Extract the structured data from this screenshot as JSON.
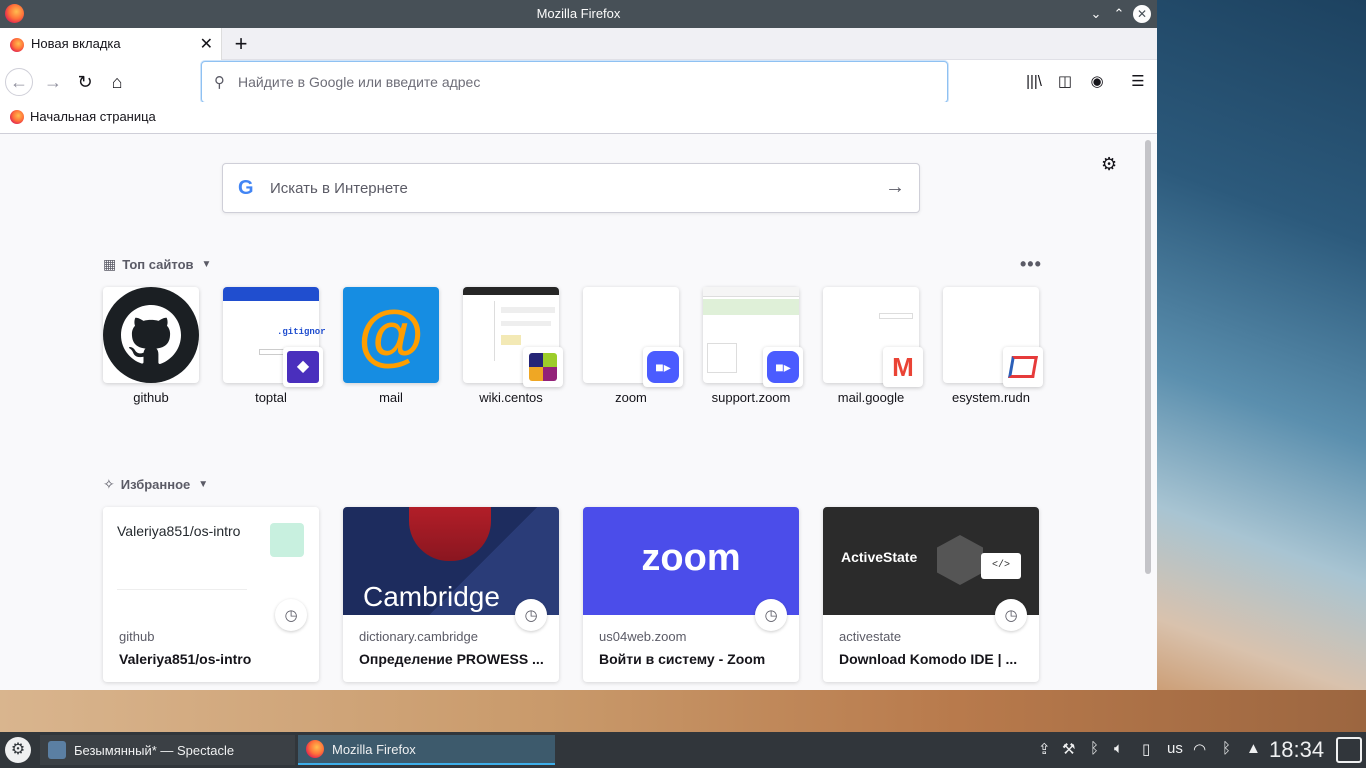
{
  "window": {
    "title": "Mozilla Firefox"
  },
  "tab": {
    "label": "Новая вкладка"
  },
  "urlbar": {
    "placeholder": "Найдите в Google или введите адрес"
  },
  "bookmarks": [
    {
      "label": "Начальная страница"
    }
  ],
  "search": {
    "placeholder": "Искать в Интернете"
  },
  "top_sites": {
    "heading": "Топ сайтов",
    "tiles": [
      {
        "label": "github"
      },
      {
        "label": "toptal"
      },
      {
        "label": "mail"
      },
      {
        "label": "wiki.centos"
      },
      {
        "label": "zoom"
      },
      {
        "label": "support.zoom"
      },
      {
        "label": "mail.google"
      },
      {
        "label": "esystem.rudn"
      }
    ]
  },
  "highlights": {
    "heading": "Избранное",
    "cards": [
      {
        "host": "github",
        "title": "Valeriya851/os-intro",
        "preview_title": "Valeriya851/os-intro"
      },
      {
        "host": "dictionary.cambridge",
        "title": "Определение PROWESS ...",
        "preview_title": "Cambridge"
      },
      {
        "host": "us04web.zoom",
        "title": "Войти в систему - Zoom",
        "preview_title": "zoom"
      },
      {
        "host": "activestate",
        "title": "Download Komodo IDE | ...",
        "preview_title": "ActiveState"
      }
    ]
  },
  "taskbar": {
    "tasks": [
      {
        "label": "Безымянный* — Spectacle"
      },
      {
        "label": "Mozilla Firefox"
      }
    ],
    "keyboard_layout": "us",
    "clock": "18:34"
  }
}
